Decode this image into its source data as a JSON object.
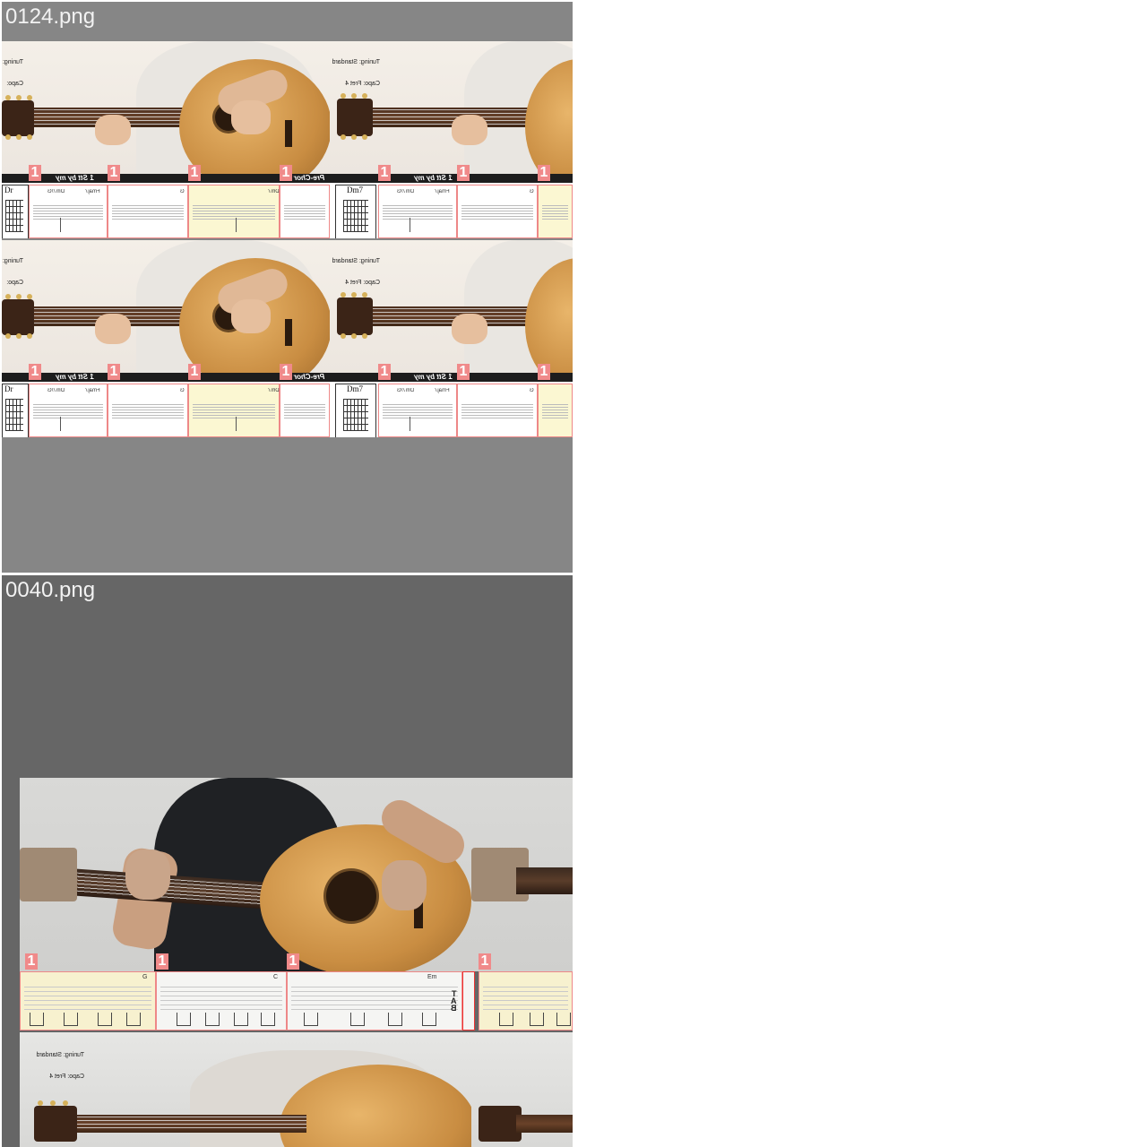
{
  "panels": [
    {
      "title": "0124.png",
      "capo_lines": [
        "Tuning: St",
        "Capo:"
      ],
      "capo_lines_right": [
        "Tuning: Standard",
        "Capo: Fret 4"
      ],
      "topbar_label": "Pre-Chor",
      "topbar_label_right": "1 Stt by my",
      "chord_name": "Dm7",
      "chord_name_left": "Dr",
      "measure_marker": "1",
      "measure_labels": [
        "Dm7/G",
        "Fmaj7",
        "G",
        "Dm7"
      ]
    },
    {
      "title": "0040.png",
      "capo_lines": [
        "Tuning: Standard",
        "Capo: Fret 4"
      ],
      "measure_marker": "1",
      "measure_labels": [
        "G",
        "C",
        "Em"
      ],
      "tab_clef": [
        "T",
        "A",
        "B"
      ]
    }
  ]
}
